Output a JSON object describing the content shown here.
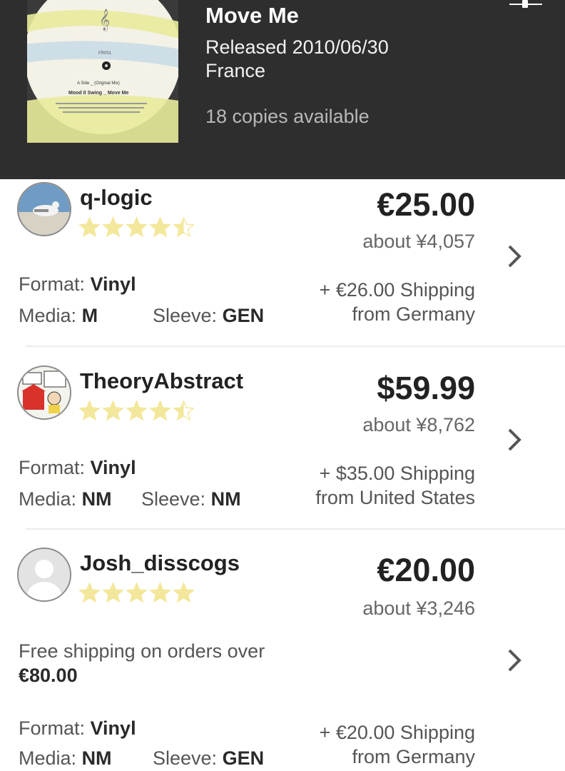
{
  "release": {
    "title": "Move Me",
    "released": "Released 2010/06/30",
    "country": "France",
    "copies": "18 copies available",
    "cover_label": {
      "catalog": "FR001",
      "side": "A Side _ (Original Mix)",
      "artist_title": "Mood II Swing _ Move Me"
    }
  },
  "icons": {
    "filter": "slider-filter-icon",
    "chevron": "chevron-right-icon",
    "star": "star-icon"
  },
  "colors": {
    "header_bg": "#2e2e2e",
    "star": "#f3e79b",
    "star_empty": "#ffffff"
  },
  "listings": [
    {
      "seller": "q-logic",
      "rating": 4.5,
      "price": "€25.00",
      "approx": "about ¥4,057",
      "format_label": "Format:",
      "format": "Vinyl",
      "media_label": "Media:",
      "media": "M",
      "sleeve_label": "Sleeve:",
      "sleeve": "GEN",
      "shipping": "+ €26.00 Shipping",
      "from": "from Germany"
    },
    {
      "seller": "TheoryAbstract",
      "rating": 4.5,
      "price": "$59.99",
      "approx": "about ¥8,762",
      "format_label": "Format:",
      "format": "Vinyl",
      "media_label": "Media:",
      "media": "NM",
      "sleeve_label": "Sleeve:",
      "sleeve": "NM",
      "shipping": "+ $35.00 Shipping",
      "from": "from United States"
    },
    {
      "seller": "Josh_disscogs",
      "rating": 5,
      "price": "€20.00",
      "approx": "about ¥3,246",
      "free_shipping_text": "Free shipping on orders over",
      "free_shipping_amount": "€80.00",
      "format_label": "Format:",
      "format": "Vinyl",
      "media_label": "Media:",
      "media": "NM",
      "sleeve_label": "Sleeve:",
      "sleeve": "GEN",
      "shipping": "+ €20.00 Shipping",
      "from": "from Germany"
    }
  ]
}
